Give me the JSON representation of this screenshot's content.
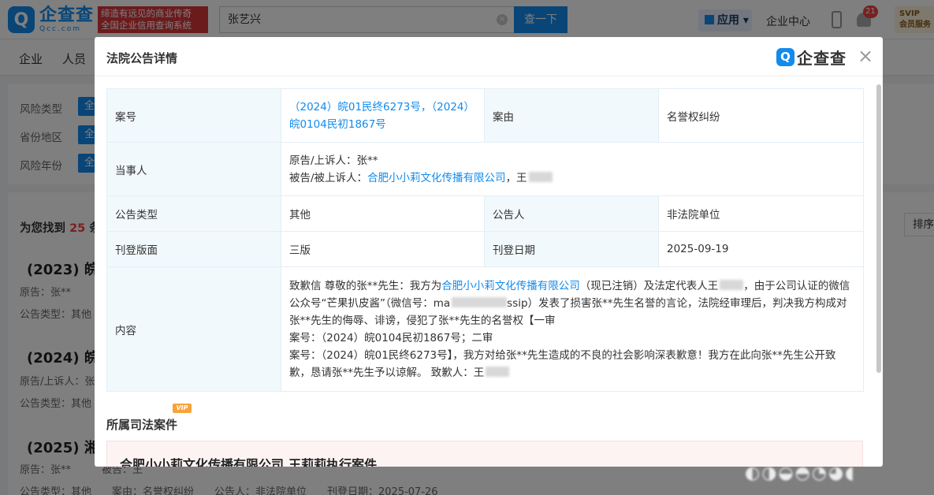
{
  "header": {
    "logo_cn": "企查查",
    "logo_en": "Qcc.com",
    "slogan_line1": "缔造有远见的商业传奇",
    "slogan_line2": "全国企业信用查询系统",
    "search_value": "张艺兴",
    "search_button": "查一下",
    "app_label": "应用",
    "enterprise_center": "企业中心",
    "notification_count": "21",
    "svip_line1": "SVIP",
    "svip_line2": "会员服务"
  },
  "nav": {
    "items": [
      "企业",
      "人员"
    ]
  },
  "filters": {
    "rows": [
      {
        "label": "风险类型",
        "chip": "全"
      },
      {
        "label": "省份地区",
        "chip": "全"
      },
      {
        "label": "风险年份",
        "chip": "全"
      }
    ]
  },
  "results": {
    "prefix": "为您找到",
    "count": "25",
    "suffix": "条",
    "sort_label": "排序",
    "cases": [
      {
        "title": "(2023) 皖",
        "line1": "原告：张**",
        "line2": "公告类型：其他"
      },
      {
        "title": "(2024) 皖",
        "line1": "原告/上诉人：张",
        "line2": "公告类型：其他"
      },
      {
        "title": "(2025) 湘",
        "line1": "原告：张**　　　被告：王",
        "line2": "公告类型：其他　　案由：名誉权纠纷　　公告人：非法院单位　　刊登日期：2025-07-26"
      }
    ]
  },
  "dialog": {
    "title": "法院公告详情",
    "logo_text": "企查查",
    "close": "×",
    "rows": {
      "case_no_label": "案号",
      "case_no_value": "（2024）皖01民终6273号，（2024）皖0104民初1867号",
      "cause_label": "案由",
      "cause_value": "名誉权纠纷",
      "parties_label": "当事人",
      "plaintiff": "原告/上诉人：张**",
      "defendant_prefix": "被告/被上诉人：",
      "defendant_company": "合肥小小莉文化传播有限公司",
      "defendant_sep": "，王",
      "type_label": "公告类型",
      "type_value": "其他",
      "announcer_label": "公告人",
      "announcer_value": "非法院单位",
      "page_label": "刊登版面",
      "page_value": "三版",
      "date_label": "刊登日期",
      "date_value": "2025-09-19",
      "content_label": "内容",
      "content_p1a": "致歉信 尊敬的张**先生：我方为",
      "content_company": "合肥小小莉文化传播有限公司",
      "content_p1b": "（现已注销）及法定代表人王",
      "content_p1c": "，由于公司认证的微信公众号“芒果扒皮酱”（微信号：ma",
      "content_p1d": "ssip）发表了损害张**先生名誉的言论，法院经审理后，判决我方构成对张**先生的侮辱、诽谤，侵犯了张**先生的名誉权【一审",
      "content_p2": "案号：（2024）皖0104民初1867号；二审",
      "content_p3": "案号：（2024）皖01民终6273号】，我方对给张**先生造成的不良的社会影响深表歉意！我方在此向张**先生公开致歉，恳请张**先生予以谅解。 致歉人：王"
    },
    "related_title": "所属司法案件",
    "vip_tag": "VIP",
    "related_case_title": "合肥小小莉文化传播有限公司,王莉莉执行案件"
  },
  "colors": {
    "brand": "#128bed",
    "alert": "#f04142",
    "label_bg": "#f2f9fc"
  }
}
